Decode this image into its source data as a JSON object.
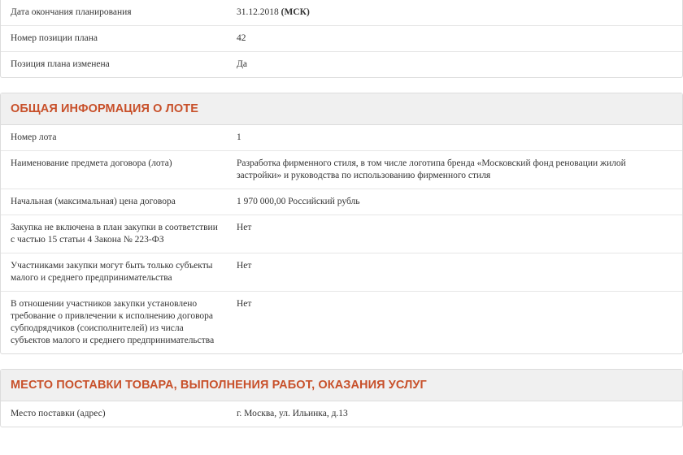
{
  "top_rows": [
    {
      "label": "Дата окончания планирования",
      "value": "31.12.2018",
      "value_suffix": "(МСК)"
    },
    {
      "label": "Номер позиции плана",
      "value": "42"
    },
    {
      "label": "Позиция плана изменена",
      "value": "Да"
    }
  ],
  "lot_section": {
    "title": "ОБЩАЯ ИНФОРМАЦИЯ О ЛОТЕ",
    "rows": [
      {
        "label": "Номер лота",
        "value": "1"
      },
      {
        "label": "Наименование предмета договора (лота)",
        "value": "Разработка фирменного стиля, в том числе логотипа бренда «Московский фонд реновации жилой застройки» и руководства по использованию фирменного стиля"
      },
      {
        "label": "Начальная (максимальная) цена договора",
        "value": "1 970 000,00 Российский рубль"
      },
      {
        "label": "Закупка не включена в план закупки в соответствии с частью 15 статьи 4 Закона № 223-ФЗ",
        "value": "Нет"
      },
      {
        "label": "Участниками закупки могут быть только субъекты малого и среднего предпринимательства",
        "value": "Нет"
      },
      {
        "label": "В отношении участников закупки установлено требование о привлечении к исполнению договора субподрядчиков (соисполнителей) из числа субъектов малого и среднего предпринимательства",
        "value": "Нет"
      }
    ]
  },
  "delivery_section": {
    "title": "МЕСТО ПОСТАВКИ ТОВАРА, ВЫПОЛНЕНИЯ РАБОТ, ОКАЗАНИЯ УСЛУГ",
    "rows": [
      {
        "label": "Место поставки (адрес)",
        "value": "г. Москва, ул. Ильинка, д.13"
      }
    ]
  }
}
